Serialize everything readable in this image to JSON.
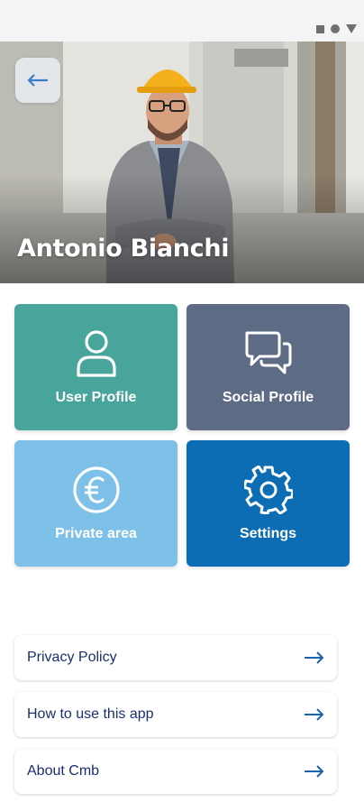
{
  "colors": {
    "tile_user_profile": "#48a59b",
    "tile_social_profile": "#5e6b85",
    "tile_private_area": "#7ec1e8",
    "tile_settings": "#0c6db5",
    "link_text": "#1b2f6e",
    "link_arrow": "#1a63b3"
  },
  "header": {
    "back_icon": "arrow-left-icon",
    "user_name": "Antonio Bianchi"
  },
  "tiles": [
    {
      "label": "User Profile",
      "icon": "user-icon"
    },
    {
      "label": "Social Profile",
      "icon": "chat-bubbles-icon"
    },
    {
      "label": "Private area",
      "icon": "euro-icon"
    },
    {
      "label": "Settings",
      "icon": "gear-icon"
    }
  ],
  "links": [
    {
      "label": "Privacy Policy",
      "icon": "arrow-right-icon"
    },
    {
      "label": "How to use this app",
      "icon": "arrow-right-icon"
    },
    {
      "label": "About Cmb",
      "icon": "arrow-right-icon"
    }
  ]
}
